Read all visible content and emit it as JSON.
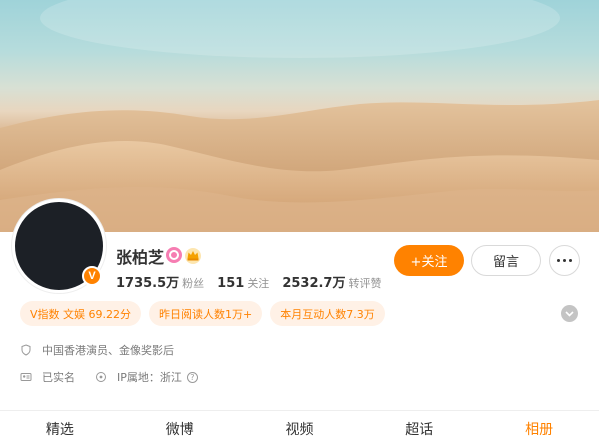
{
  "profile": {
    "name": "张柏芝",
    "verified_badge": "V",
    "stats": [
      {
        "value": "1735.5万",
        "label": "粉丝"
      },
      {
        "value": "151",
        "label": "关注"
      },
      {
        "value": "2532.7万",
        "label": "转评赞"
      }
    ]
  },
  "actions": {
    "follow_label": "+关注",
    "message_label": "留言"
  },
  "tags": [
    "V指数 文娱 69.22分",
    "昨日阅读人数1万+",
    "本月互动人数7.3万"
  ],
  "info": {
    "description": "中国香港演员、金像奖影后",
    "real_name": "已实名",
    "ip_location": "IP属地：浙江",
    "help_glyph": "?"
  },
  "tabs": [
    {
      "label": "精选",
      "active": false
    },
    {
      "label": "微博",
      "active": false
    },
    {
      "label": "视频",
      "active": false
    },
    {
      "label": "超话",
      "active": false
    },
    {
      "label": "相册",
      "active": true
    }
  ],
  "colors": {
    "accent": "#ff8200",
    "tag_bg": "#fff1e6",
    "badge_pink": "#f67db2"
  },
  "icons": {
    "verified": "v-badge-icon",
    "pink_badge": "pink-badge-icon",
    "crown": "crown-icon",
    "more": "more-dots-icon",
    "expand": "chevron-down-icon",
    "description": "shield-icon",
    "real_name": "id-card-icon",
    "ip": "location-pin-icon",
    "help": "help-icon"
  }
}
